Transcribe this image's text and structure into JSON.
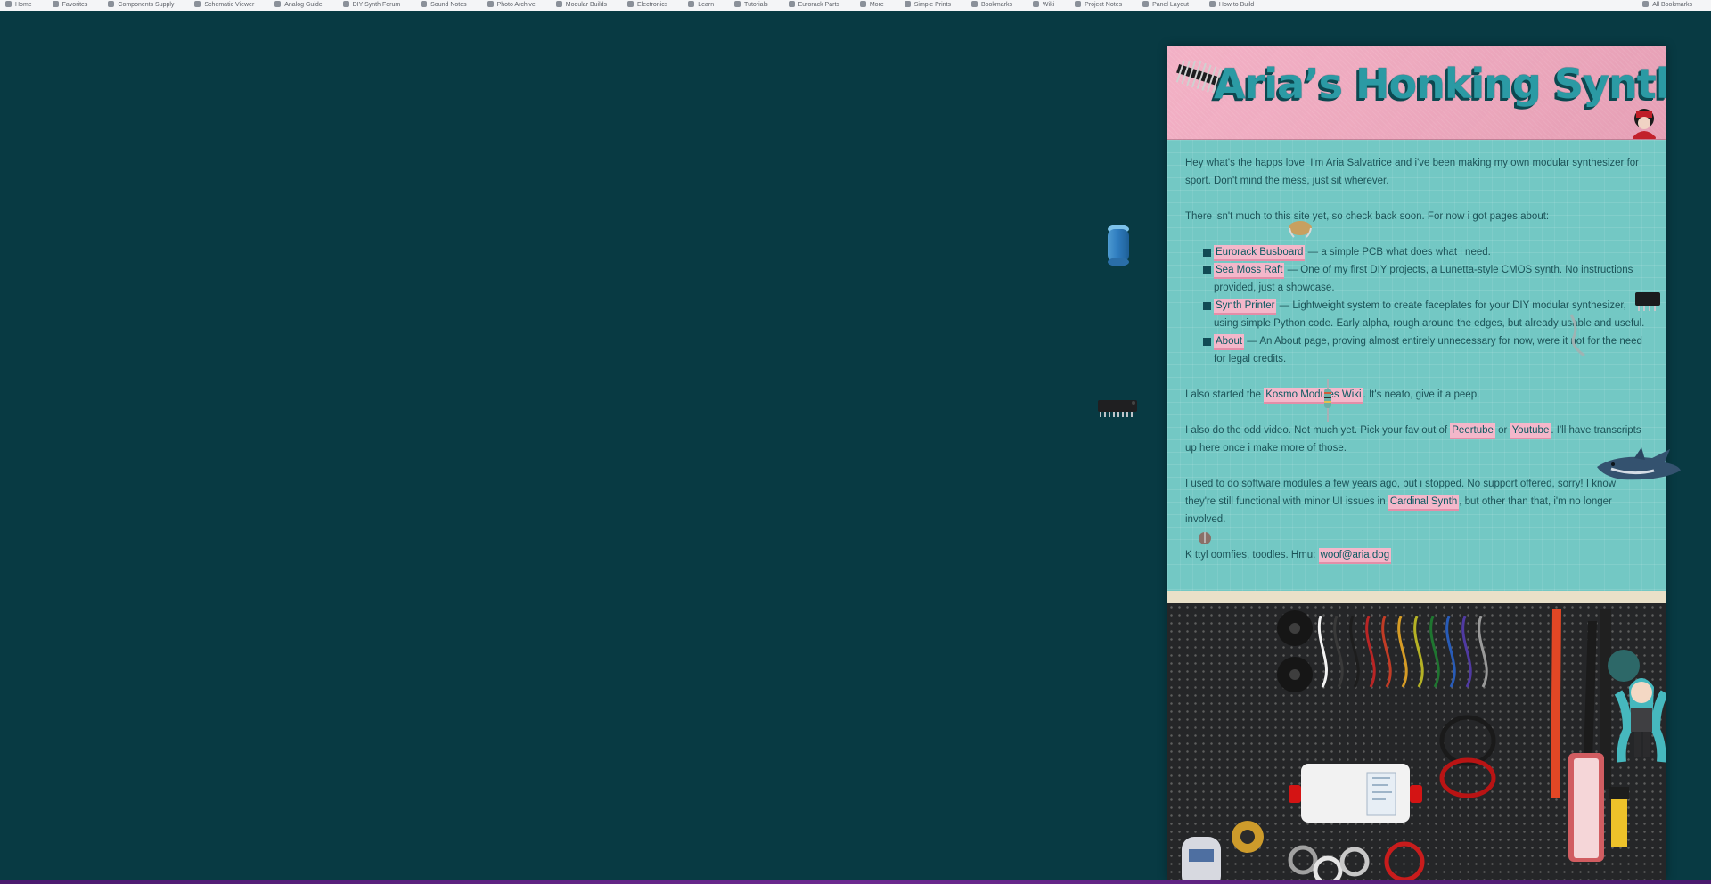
{
  "bookmarks": {
    "items": [
      "Home",
      "Favorites",
      "Components Supply",
      "Schematic Viewer",
      "Analog Guide",
      "DIY Synth Forum",
      "Sound Notes",
      "Photo Archive",
      "Modular Builds",
      "Electronics",
      "Learn",
      "Tutorials",
      "Eurorack Parts",
      "More",
      "Simple Prints",
      "Bookmarks",
      "Wiki",
      "Project Notes",
      "Panel Layout",
      "How to Build"
    ],
    "right_label": "All Bookmarks"
  },
  "page": {
    "title": "Aria’s Honking Synths"
  },
  "content": {
    "intro": "Hey what's the happs love. I'm Aria Salvatrice and i've been making my own modular synthesizer for sport. Don't mind the mess, just sit wherever.",
    "pages_intro": "There isn't much to this site yet, so check back soon. For now i got pages about:",
    "links": [
      {
        "label": "Eurorack Busboard",
        "desc": " — a simple PCB what does what i need."
      },
      {
        "label": "Sea Moss Raft",
        "desc": " — One of my first DIY projects, a Lunetta-style CMOS synth. No instructions provided, just a showcase."
      },
      {
        "label": "Synth Printer",
        "desc": " — Lightweight system to create faceplates for your DIY modular synthesizer, using simple Python code. Early alpha, rough around the edges, but already usable and useful."
      },
      {
        "label": "About",
        "desc": " — An About page, proving almost entirely unnecessary for now, were it not for the need for legal credits."
      }
    ],
    "kosmo_prefix": "I also started the ",
    "kosmo_link": "Kosmo Modules Wiki",
    "kosmo_suffix": ". It's neato, give it a peep.",
    "video_prefix": "I also do the odd video. Not much yet. Pick your fav out of ",
    "peertube_link": "Peertube",
    "video_or": " or ",
    "youtube_link": "Youtube",
    "video_suffix": ". I'll have transcripts up here once i make more of those.",
    "software_prefix": "I used to do software modules a few years ago, but i stopped. No support offered, sorry! I know they're still functional with minor UI issues in ",
    "cardinal_link": "Cardinal Synth",
    "software_suffix": ", but other than that, i'm no longer involved.",
    "email_prefix": "K ttyl oomfies, toodles. Hmu: ",
    "email_link": "woof@aria.dog"
  },
  "colors": {
    "background": "#083a43",
    "header_pink": "#f2a8bf",
    "panel_teal": "#73c8c4",
    "link_highlight": "#f4b7ca",
    "title_teal": "#2b9aa4",
    "title_shadow": "#0c4850"
  },
  "icons": {
    "capacitor": "blue-capacitor-icon",
    "chip_left": "ic-chip-icon",
    "chip_right": "ic-chip-icon",
    "header_connector": "pin-header-icon",
    "character_header": "character-sticker-icon",
    "shark": "shark-plush-icon",
    "doll": "figure-doll-icon",
    "resistor": "resistor-icon",
    "battery": "coin-cell-icon",
    "wire": "wire-icon"
  }
}
